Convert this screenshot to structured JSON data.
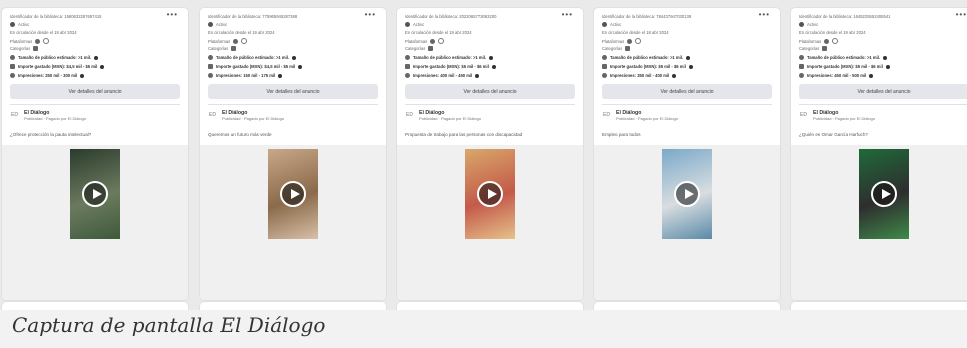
{
  "cards": [
    {
      "library_id": "Identificador de la biblioteca: 1580632287697415",
      "status": "Activo",
      "since": "En circulación desde el 19 abr 2024",
      "platforms_label": "Plataformas",
      "categories_label": "Categorías",
      "audience": "Tamaño de público estimado: >1 mil.",
      "spend": "Importe gastado (MXN): $4,5 mil - $5 mil",
      "impressions": "Impresiones: 250 mil - 300 mil",
      "details_button": "Ver detalles del anuncio",
      "advertiser": "El Diálogo",
      "sponsored": "Publicidad · Pagado por El Diálogo",
      "ad_text": "¿Ofrece protección la pauta intelectual?",
      "video_colors": [
        "#2a3b2c",
        "#6b7a5e",
        "#3d5a3a"
      ]
    },
    {
      "library_id": "Identificador de la biblioteca: 775965945287388",
      "status": "Activo",
      "since": "En circulación desde el 19 abr 2024",
      "platforms_label": "Plataformas",
      "categories_label": "Categorías",
      "audience": "Tamaño de público estimado: >1 mil.",
      "spend": "Importe gastado (MXN): $4,5 mil - $5 mil",
      "impressions": "Impresiones: 150 mil - 175 mil",
      "details_button": "Ver detalles del anuncio",
      "advertiser": "El Diálogo",
      "sponsored": "Publicidad · Pagado por El Diálogo",
      "ad_text": "Queremos un futuro más verde",
      "video_colors": [
        "#c9a88a",
        "#8a6a4a",
        "#d8c0a8"
      ]
    },
    {
      "library_id": "Identificador de la biblioteca: 2022065773063200",
      "status": "Activo",
      "since": "En circulación desde el 19 abr 2024",
      "platforms_label": "Plataformas",
      "categories_label": "Categorías",
      "audience": "Tamaño de público estimado: >1 mil.",
      "spend": "Importe gastado (MXN): $5 mil - $6 mil",
      "impressions": "Impresiones: 400 mil - 450 mil",
      "details_button": "Ver detalles del anuncio",
      "advertiser": "El Diálogo",
      "sponsored": "Publicidad · Pagado por El Diálogo",
      "ad_text": "Propuesta de trabajo para las personas con discapacidad",
      "video_colors": [
        "#d9a86a",
        "#c45a4a",
        "#e6c28a"
      ]
    },
    {
      "library_id": "Identificador de la biblioteca: 784437947030139",
      "status": "Activo",
      "since": "En circulación desde el 18 abr 2024",
      "platforms_label": "Plataformas",
      "categories_label": "Categorías",
      "audience": "Tamaño de público estimado: >1 mil.",
      "spend": "Importe gastado (MXN): $5 mil - $6 mil",
      "impressions": "Impresiones: 350 mil - 400 mil",
      "details_button": "Ver detalles del anuncio",
      "advertiser": "El Diálogo",
      "sponsored": "Publicidad · Pagado por El Diálogo",
      "ad_text": "Empleo para todos",
      "video_colors": [
        "#7aa9c9",
        "#d8dde0",
        "#5a8aa8"
      ]
    },
    {
      "library_id": "Identificador de la biblioteca: 1648225552406541",
      "status": "Activo",
      "since": "En circulación desde el 19 abr 2024",
      "platforms_label": "Plataformas",
      "categories_label": "Categorías",
      "audience": "Tamaño de público estimado: >1 mil.",
      "spend": "Importe gastado (MXN): $5 mil - $6 mil",
      "impressions": "Impresiones: 450 mil - 500 mil",
      "details_button": "Ver detalles del anuncio",
      "advertiser": "El Diálogo",
      "sponsored": "Publicidad · Pagado por El Diálogo",
      "ad_text": "¿Quién es Omar García Harfuch?",
      "video_colors": [
        "#1f6a3a",
        "#2e2e2e",
        "#3f8a4a"
      ]
    }
  ],
  "caption": "Captura de pantalla El Diálogo"
}
